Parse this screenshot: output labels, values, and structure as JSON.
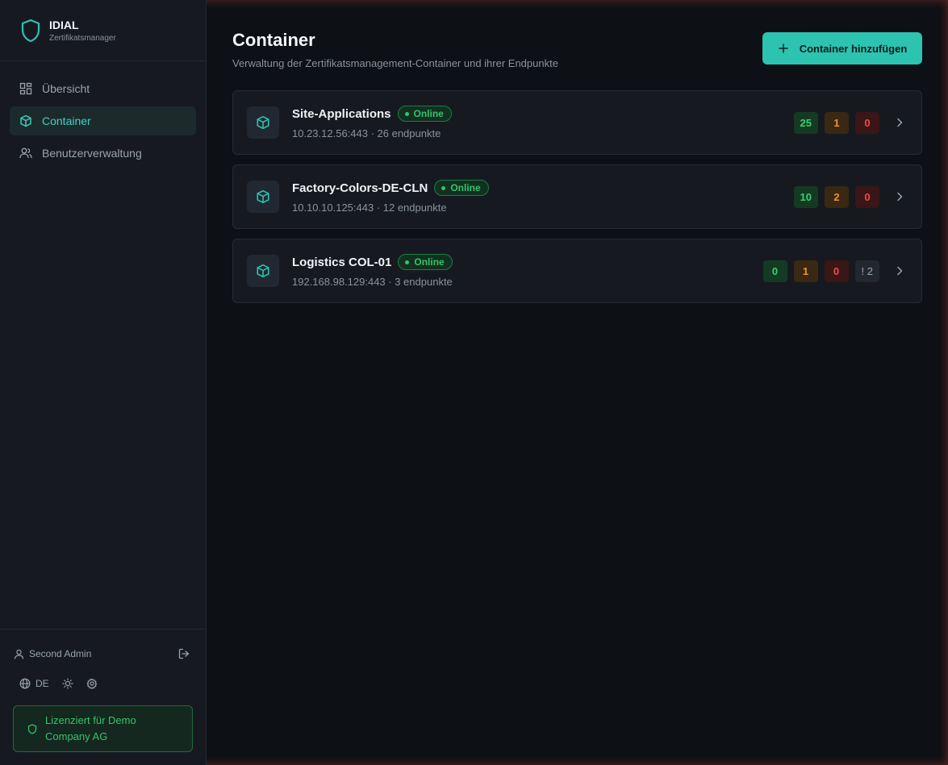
{
  "brand": {
    "name": "IDIAL",
    "subtitle": "Zertifikatsmanager",
    "icon": "shield-icon"
  },
  "nav": [
    {
      "label": "Übersicht",
      "icon": "dashboard-icon",
      "active": false
    },
    {
      "label": "Container",
      "icon": "box-icon",
      "active": true
    },
    {
      "label": "Benutzerverwaltung",
      "icon": "users-icon",
      "active": false
    }
  ],
  "user": {
    "name": "Second Admin",
    "icon": "user-icon"
  },
  "settings": {
    "language": "DE"
  },
  "license": {
    "text": "Lizenziert für Demo Company AG"
  },
  "header": {
    "title": "Container",
    "subtitle": "Verwaltung der Zertifikatsmanagement-Container und ihrer Endpunkte",
    "add_button": "Container hinzufügen"
  },
  "containers": [
    {
      "name": "Site-Applications",
      "status": "Online",
      "address": "10.23.12.56:443 · 26 endpunkte",
      "ok": "25",
      "warn": "1",
      "err": "0"
    },
    {
      "name": "Factory-Colors-DE-CLN",
      "status": "Online",
      "address": "10.10.10.125:443 · 12 endpunkte",
      "ok": "10",
      "warn": "2",
      "err": "0"
    },
    {
      "name": "Logistics COL-01",
      "status": "Online",
      "address": "192.168.98.129:443 · 3 endpunkte",
      "ok": "0",
      "warn": "1",
      "err": "0",
      "unknown": "! 2"
    }
  ],
  "colors": {
    "accent": "#2cc3b1",
    "success": "#36c26b",
    "warning": "#f0932c",
    "danger": "#ef4a4a"
  }
}
